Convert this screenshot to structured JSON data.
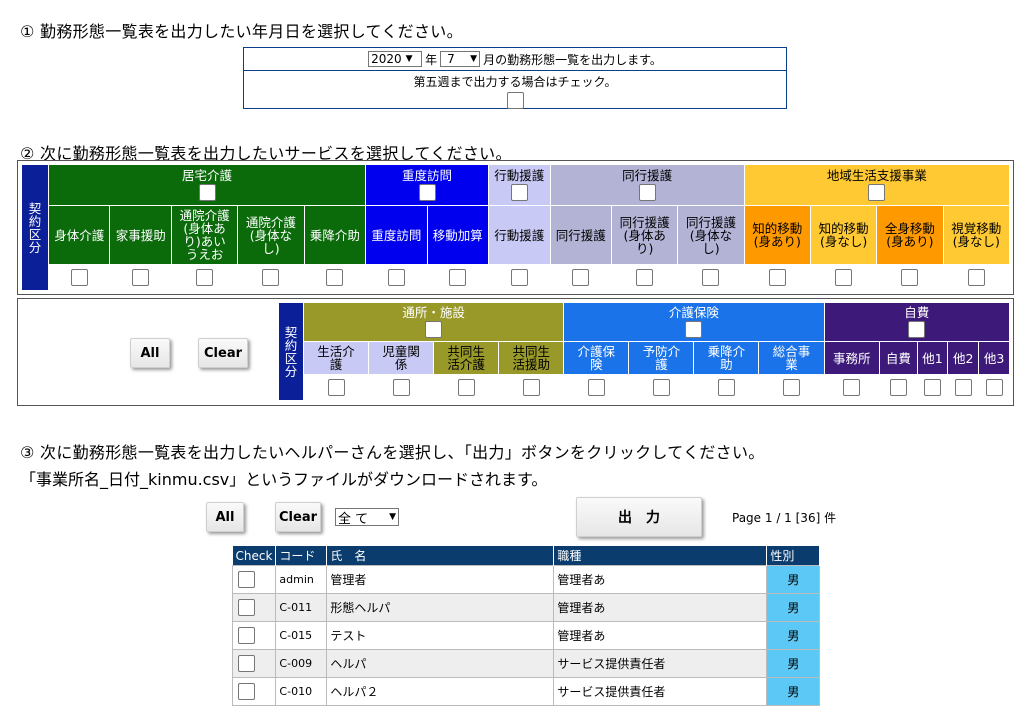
{
  "section1": {
    "heading": "① 勤務形態一覧表を出力したい年月日を選択してください。",
    "year": "2020",
    "year_label": "年",
    "month": "7",
    "month_label": "月の勤務形態一覧を出力します。",
    "fifth_week_label": "第五週まで出力する場合はチェック。"
  },
  "section2": {
    "heading": "② 次に勤務形態一覧表を出力したいサービスを選択してください。",
    "keiyaku": "契約区分",
    "table1": {
      "groups": [
        {
          "label": "居宅介護",
          "color": "#0b6b0b",
          "span": 5
        },
        {
          "label": "重度訪問",
          "color": "#0000ee",
          "span": 2
        },
        {
          "label": "行動援護",
          "color": "#c9c9f5",
          "span": 1
        },
        {
          "label": "同行援護",
          "color": "#b3b3d6",
          "span": 3
        },
        {
          "label": "地域生活支援事業",
          "color": "#ffc933",
          "span": 4
        }
      ],
      "columns": [
        {
          "label": "身体介護",
          "color": "#0b6b0b"
        },
        {
          "label": "家事援助",
          "color": "#0b6b0b"
        },
        {
          "label": "通院介護(身体あり)あいうえお",
          "color": "#0b6b0b"
        },
        {
          "label": "通院介護(身体なし)",
          "color": "#0b6b0b"
        },
        {
          "label": "乗降介助",
          "color": "#0b6b0b"
        },
        {
          "label": "重度訪問",
          "color": "#0000ee"
        },
        {
          "label": "移動加算",
          "color": "#0000ee"
        },
        {
          "label": "行動援護",
          "color": "#c9c9f5"
        },
        {
          "label": "同行援護",
          "color": "#b3b3d6"
        },
        {
          "label": "同行援護(身体あり)",
          "color": "#b3b3d6"
        },
        {
          "label": "同行援護(身体なし)",
          "color": "#b3b3d6"
        },
        {
          "label": "知的移動(身あり)",
          "color": "#ff9900"
        },
        {
          "label": "知的移動(身なし)",
          "color": "#ffc933"
        },
        {
          "label": "全身移動(身あり)",
          "color": "#ff9900"
        },
        {
          "label": "視覚移動(身なし)",
          "color": "#ffc933"
        }
      ]
    },
    "table2": {
      "all_label": "All",
      "clear_label": "Clear",
      "groups": [
        {
          "label": "通所・施設",
          "color": "#99992a",
          "span": 4
        },
        {
          "label": "介護保険",
          "color": "#1a73e8",
          "span": 4
        },
        {
          "label": "自費",
          "color": "#3d1a7a",
          "span": 5
        }
      ],
      "columns": [
        {
          "label": "生活介護",
          "color": "#c9c9f5"
        },
        {
          "label": "児童関係",
          "color": "#c9c9f5"
        },
        {
          "label": "共同生活介護",
          "color": "#99992a"
        },
        {
          "label": "共同生活援助",
          "color": "#99992a"
        },
        {
          "label": "介護保険",
          "color": "#1a73e8"
        },
        {
          "label": "予防介護",
          "color": "#1a73e8"
        },
        {
          "label": "乗降介助",
          "color": "#1a73e8"
        },
        {
          "label": "総合事業",
          "color": "#1a73e8"
        },
        {
          "label": "事務所",
          "color": "#3d1a7a"
        },
        {
          "label": "自費",
          "color": "#3d1a7a"
        },
        {
          "label": "他1",
          "color": "#3d1a7a"
        },
        {
          "label": "他2",
          "color": "#3d1a7a"
        },
        {
          "label": "他3",
          "color": "#3d1a7a"
        }
      ]
    }
  },
  "section3": {
    "heading": "③ 次に勤務形態一覧表を出力したいヘルパーさんを選択し、「出力」ボタンをクリックしてください。",
    "subheading": "「事業所名_日付_kinmu.csv」というファイルがダウンロードされます。",
    "all_label": "All",
    "clear_label": "Clear",
    "filter_value": "全 て",
    "output_label": "出　力",
    "page_info": "Page 1 / 1 [36] 件",
    "columns": [
      "Check",
      "コード",
      "氏　名",
      "職種",
      "性別"
    ],
    "rows": [
      {
        "code": "admin",
        "name": "管理者",
        "job": "管理者あ",
        "sex": "男"
      },
      {
        "code": "C-011",
        "name": "形態ヘルパ",
        "job": "管理者あ",
        "sex": "男"
      },
      {
        "code": "C-015",
        "name": "テスト",
        "job": "管理者あ",
        "sex": "男"
      },
      {
        "code": "C-009",
        "name": "ヘルパ",
        "job": "サービス提供責任者",
        "sex": "男"
      },
      {
        "code": "C-010",
        "name": "ヘルパ２",
        "job": "サービス提供責任者",
        "sex": "男"
      }
    ]
  }
}
